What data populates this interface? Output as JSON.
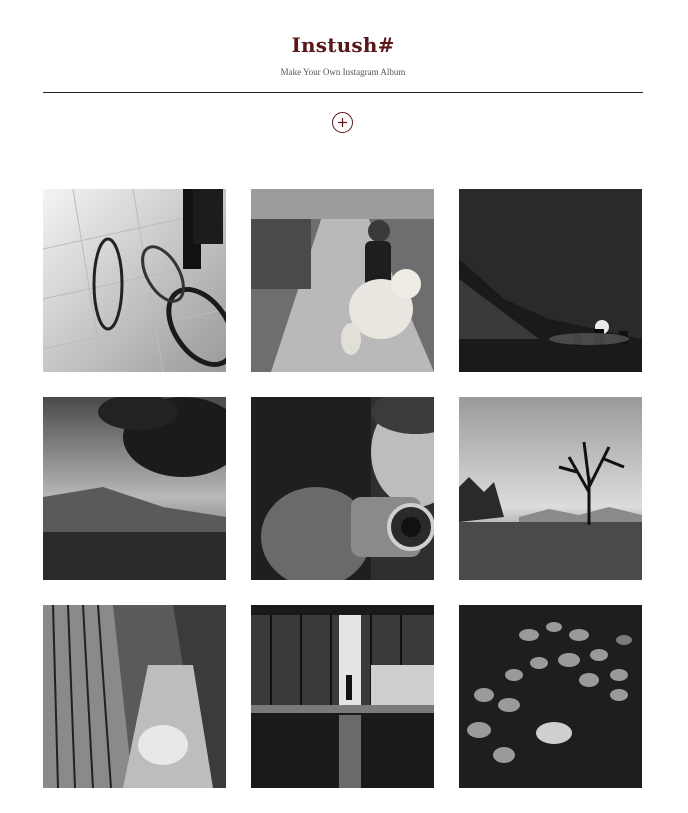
{
  "header": {
    "title": "Instush#",
    "subtitle": "Make Your Own Instagram Album"
  },
  "add_button": {
    "icon": "plus-icon"
  },
  "photos": [
    {
      "name": "bicycle-shadow"
    },
    {
      "name": "girl-with-teddy-bear"
    },
    {
      "name": "night-campfire"
    },
    {
      "name": "hills-tree-dusk"
    },
    {
      "name": "boy-with-camera"
    },
    {
      "name": "lone-tree-lake"
    },
    {
      "name": "building-reflection-clouds"
    },
    {
      "name": "lobby-reflection-night"
    },
    {
      "name": "lily-pads"
    }
  ],
  "colors": {
    "accent": "#5a1717",
    "rule": "#222222"
  }
}
